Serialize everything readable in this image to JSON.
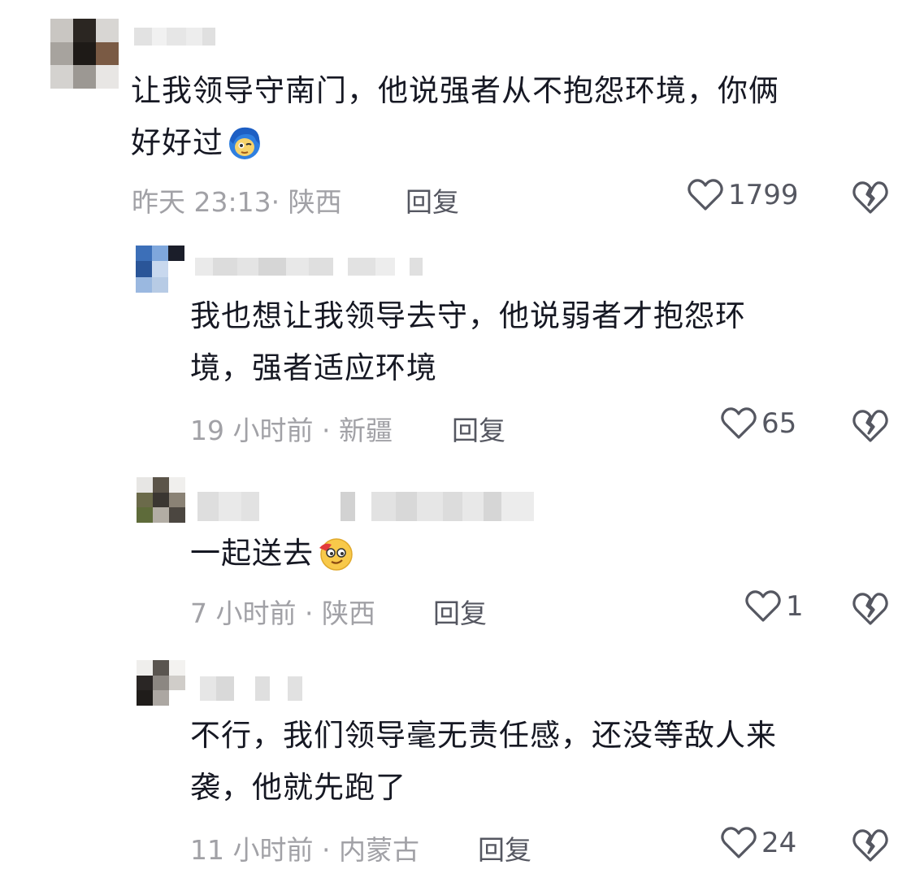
{
  "comments": [
    {
      "text_lines": [
        "让我领导守南门，他说强者从不抱怨环境，你俩",
        "好好过"
      ],
      "emoji": "blue-hair-crying-emoji",
      "time": "昨天 23:13",
      "location": "陕西",
      "reply_label": "回复",
      "likes": "1799"
    },
    {
      "text_lines": [
        "我也想让我领导去守，他说弱者才抱怨环",
        "境，强者适应环境"
      ],
      "time": "19 小时前",
      "location": "新疆",
      "reply_label": "回复",
      "likes": "65"
    },
    {
      "text_lines": [
        "一起送去"
      ],
      "emoji": "smug-face-emoji",
      "time": "7 小时前",
      "location": "陕西",
      "reply_label": "回复",
      "likes": "1"
    },
    {
      "text_lines": [
        "不行，我们领导毫无责任感，还没等敌人来",
        "袭，他就先跑了"
      ],
      "time": "11 小时前",
      "location": "内蒙古",
      "reply_label": "回复",
      "likes": "24"
    }
  ],
  "meta_separator": "·",
  "colors": {
    "text": "#161823",
    "meta": "#a1a1a6",
    "action": "#555761"
  },
  "icons": {
    "like": "heart-outline-icon",
    "dislike": "broken-heart-icon"
  }
}
